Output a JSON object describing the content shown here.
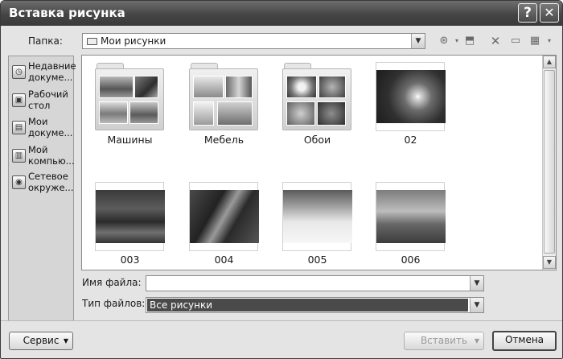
{
  "window": {
    "title": "Вставка рисунка"
  },
  "titlebar_buttons": {
    "help": "?",
    "close": "✕"
  },
  "folder_label": "Папка:",
  "path": {
    "value": "Мои рисунки"
  },
  "places": [
    {
      "label": "Недавние докуме...",
      "icon": "recent-documents-icon"
    },
    {
      "label": "Рабочий стол",
      "icon": "desktop-icon"
    },
    {
      "label": "Мои докуме...",
      "icon": "my-documents-icon"
    },
    {
      "label": "Мой компью...",
      "icon": "my-computer-icon"
    },
    {
      "label": "Сетевое окруже...",
      "icon": "network-icon"
    }
  ],
  "items": [
    {
      "label": "Машины",
      "kind": "folder"
    },
    {
      "label": "Мебель",
      "kind": "folder"
    },
    {
      "label": "Обои",
      "kind": "folder"
    },
    {
      "label": "02",
      "kind": "image"
    },
    {
      "label": "003",
      "kind": "image"
    },
    {
      "label": "004",
      "kind": "image"
    },
    {
      "label": "005",
      "kind": "image"
    },
    {
      "label": "006",
      "kind": "image"
    }
  ],
  "filename": {
    "label": "Имя файла:",
    "value": ""
  },
  "filetype": {
    "label": "Тип файлов:",
    "value": "Все рисунки"
  },
  "buttons": {
    "service": "Сервис",
    "insert": "Вставить",
    "cancel": "Отмена"
  }
}
